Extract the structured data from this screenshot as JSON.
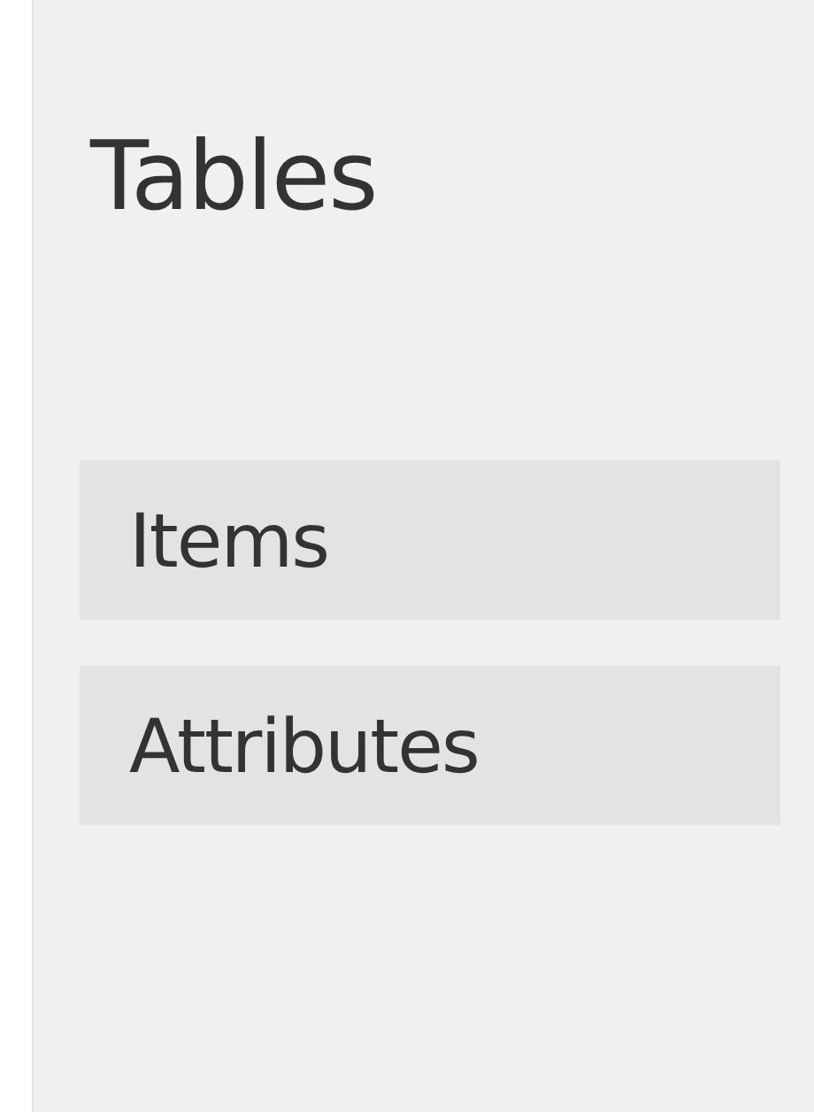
{
  "heading": "Tables",
  "items": [
    {
      "label": "Items"
    },
    {
      "label": "Attributes"
    }
  ]
}
